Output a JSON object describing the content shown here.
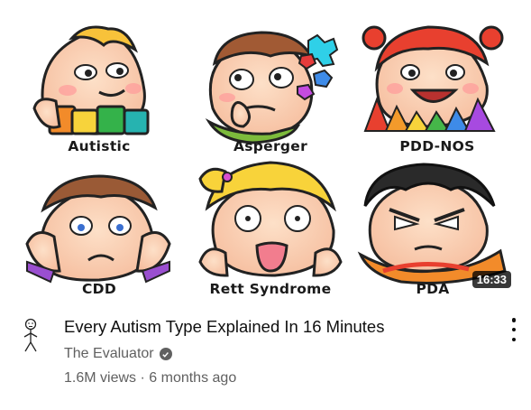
{
  "video": {
    "duration": "16:33",
    "title": "Every Autism Type Explained In 16 Minutes",
    "channel": "The Evaluator",
    "views": "1.6M views",
    "separator": "·",
    "age": "6 months ago"
  },
  "thumbnail": {
    "labels": [
      "Autistic",
      "Asperger",
      "PDD-NOS",
      "CDD",
      "Rett Syndrome",
      "PDA"
    ]
  },
  "icons": {
    "verified": "verified-check-icon",
    "menu": "more-vert-icon",
    "avatar": "stick-figure-avatar-icon"
  },
  "colors": {
    "title": "#0f0f0f",
    "secondary": "#606060",
    "duration_bg": "#000000",
    "skin": "#fcd2b4",
    "cheek": "#ff8a8a"
  }
}
